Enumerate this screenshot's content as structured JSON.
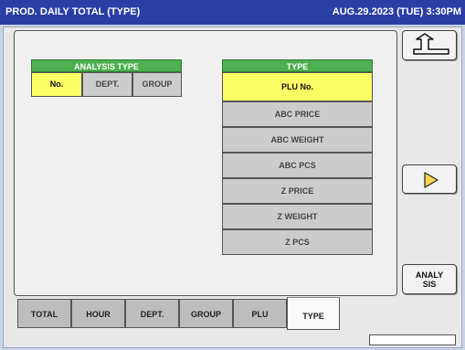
{
  "title": "PROD. DAILY TOTAL (TYPE)",
  "datetime": "AUG.29.2023 (TUE)  3:30PM",
  "analysis_type": {
    "header": "ANALYSIS TYPE",
    "options": [
      "No.",
      "DEPT.",
      "GROUP"
    ],
    "selected": "No."
  },
  "type": {
    "header": "TYPE",
    "options": [
      "PLU No.",
      "ABC PRICE",
      "ABC WEIGHT",
      "ABC PCS",
      "Z PRICE",
      "Z WEIGHT",
      "Z PCS"
    ],
    "selected": "PLU No."
  },
  "side_buttons": {
    "back_icon": "return-arrow-icon",
    "next_icon": "play-right-icon",
    "analysis_label_line1": "ANALY",
    "analysis_label_line2": "SIS"
  },
  "tabs": [
    "TOTAL",
    "HOUR",
    "DEPT.",
    "GROUP",
    "PLU",
    "TYPE"
  ],
  "active_tab": "TYPE",
  "colors": {
    "titlebar": "#2b3ea6",
    "selected": "#ffff66",
    "group_header": "#4caf50"
  }
}
